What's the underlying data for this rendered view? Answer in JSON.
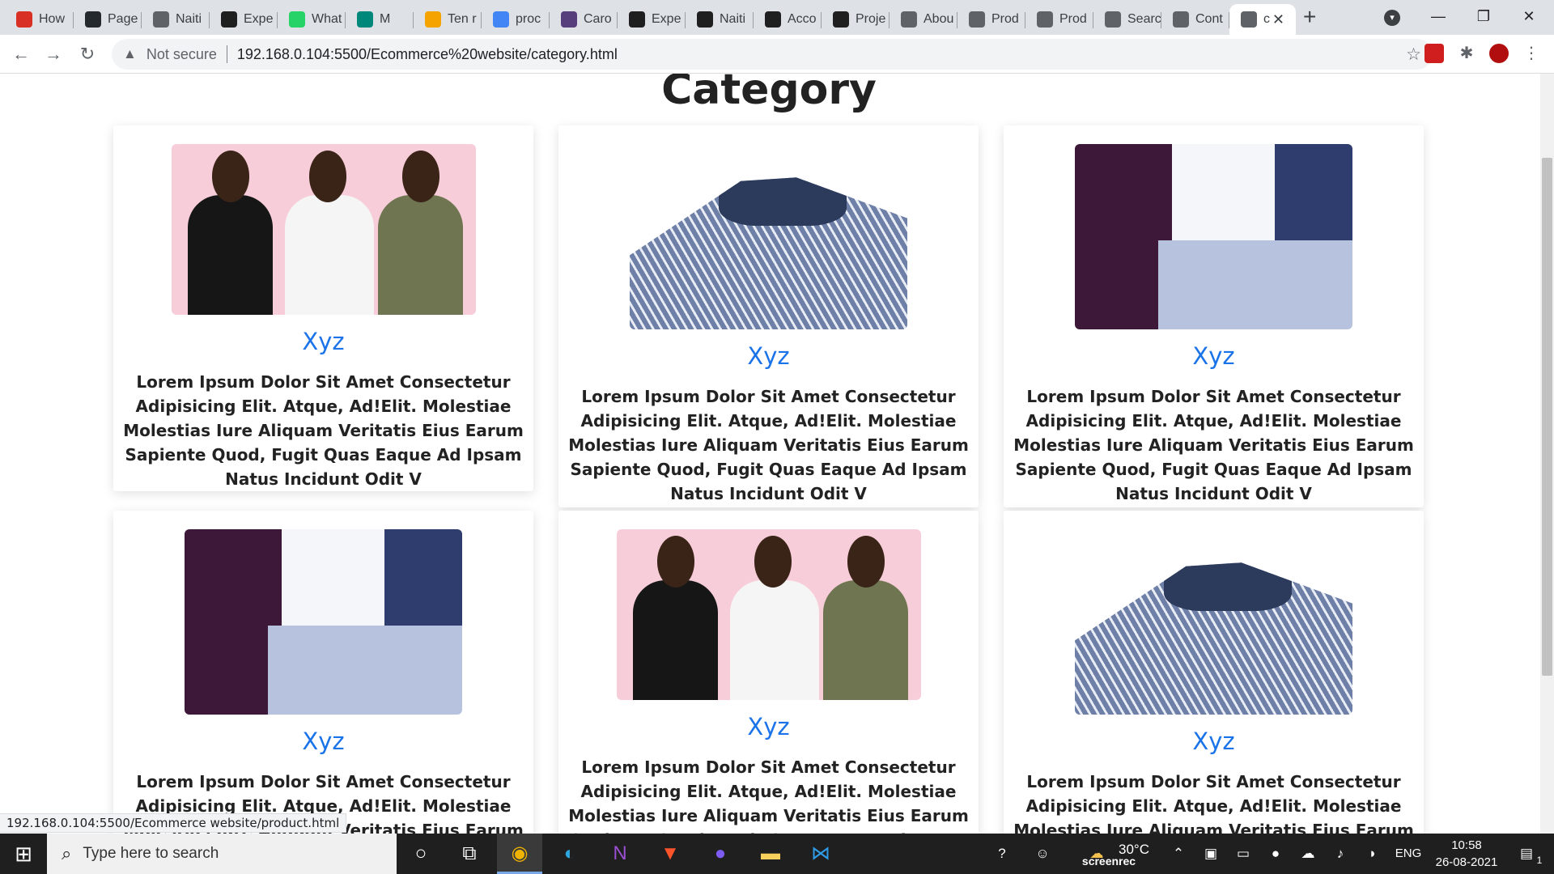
{
  "browser": {
    "tabs": [
      {
        "title": "How",
        "favicon": "gmail-icon",
        "color": "#d93025"
      },
      {
        "title": "Page",
        "favicon": "github-icon",
        "color": "#24292e"
      },
      {
        "title": "Naiti",
        "favicon": "globe-icon",
        "color": "#5f6368"
      },
      {
        "title": "Expe",
        "favicon": "np-icon",
        "color": "#1f1f1f"
      },
      {
        "title": "What",
        "favicon": "whatsapp-icon",
        "color": "#25d366"
      },
      {
        "title": "M",
        "favicon": "meet-icon",
        "color": "#00897b"
      },
      {
        "title": "Ten r",
        "favicon": "teams-icon",
        "color": "#f4a300"
      },
      {
        "title": "proc",
        "favicon": "google-icon",
        "color": "#4285f4"
      },
      {
        "title": "Caro",
        "favicon": "bootstrap-icon",
        "color": "#563d7c"
      },
      {
        "title": "Expe",
        "favicon": "np-icon",
        "color": "#1f1f1f"
      },
      {
        "title": "Naiti",
        "favicon": "np-icon",
        "color": "#1f1f1f"
      },
      {
        "title": "Acco",
        "favicon": "np-icon",
        "color": "#1f1f1f"
      },
      {
        "title": "Proje",
        "favicon": "np-icon",
        "color": "#1f1f1f"
      },
      {
        "title": "Abou",
        "favicon": "globe-icon",
        "color": "#5f6368"
      },
      {
        "title": "Prod",
        "favicon": "globe-icon",
        "color": "#5f6368"
      },
      {
        "title": "Prod",
        "favicon": "globe-icon",
        "color": "#5f6368"
      },
      {
        "title": "Searc",
        "favicon": "globe-icon",
        "color": "#5f6368"
      },
      {
        "title": "Cont",
        "favicon": "globe-icon",
        "color": "#5f6368"
      },
      {
        "title": "c",
        "favicon": "globe-icon",
        "color": "#5f6368"
      }
    ],
    "address": {
      "security_label": "Not secure",
      "url": "192.168.0.104:5500/Ecommerce%20website/category.html"
    },
    "status_url": "192.168.0.104:5500/Ecommerce website/product.html"
  },
  "page": {
    "title": "Category",
    "cards": [
      {
        "name": "Xyz",
        "image": "women-tshirts-photo",
        "description": "Lorem Ipsum Dolor Sit Amet Consectetur Adipisicing Elit. Atque, Ad!Elit. Molestiae Molestias Iure Aliquam Veritatis Eius Earum Sapiente Quod, Fugit Quas Eaque Ad Ipsam Natus Incidunt Odit V"
      },
      {
        "name": "Xyz",
        "image": "striped-shirt-photo",
        "description": "Lorem Ipsum Dolor Sit Amet Consectetur Adipisicing Elit. Atque, Ad!Elit. Molestiae Molestias Iure Aliquam Veritatis Eius Earum Sapiente Quod, Fugit Quas Eaque Ad Ipsam Natus Incidunt Odit V"
      },
      {
        "name": "Xyz",
        "image": "folded-shirts-photo",
        "description": "Lorem Ipsum Dolor Sit Amet Consectetur Adipisicing Elit. Atque, Ad!Elit. Molestiae Molestias Iure Aliquam Veritatis Eius Earum Sapiente Quod, Fugit Quas Eaque Ad Ipsam Natus Incidunt Odit V"
      },
      {
        "name": "Xyz",
        "image": "folded-shirts-photo",
        "description": "Lorem Ipsum Dolor Sit Amet Consectetur Adipisicing Elit. Atque, Ad!Elit. Molestiae Molestias Iure Aliquam Veritatis Eius Earum Sapiente Quod, Fugit Quas Eaque Ad Ipsam Natus Incidunt Odit V"
      },
      {
        "name": "Xyz",
        "image": "women-tshirts-photo",
        "description": "Lorem Ipsum Dolor Sit Amet Consectetur Adipisicing Elit. Atque, Ad!Elit. Molestiae Molestias Iure Aliquam Veritatis Eius Earum Sapiente Quod, Fugit Quas Eaque Ad Ipsam Natus Incidunt Odit V"
      },
      {
        "name": "Xyz",
        "image": "striped-shirt-photo",
        "description": "Lorem Ipsum Dolor Sit Amet Consectetur Adipisicing Elit. Atque, Ad!Elit. Molestiae Molestias Iure Aliquam Veritatis Eius Earum Sapiente Quod, Fugit Quas Eaque Ad Ipsam Natus Incidunt Odit V"
      }
    ],
    "colors": {
      "link": "#1a73e8",
      "text": "#222222"
    }
  },
  "taskbar": {
    "search_placeholder": "Type here to search",
    "weather": "30°C",
    "brand": "screenrec",
    "language": "ENG",
    "time": "10:58",
    "date": "26-08-2021",
    "notification_count": "1"
  }
}
